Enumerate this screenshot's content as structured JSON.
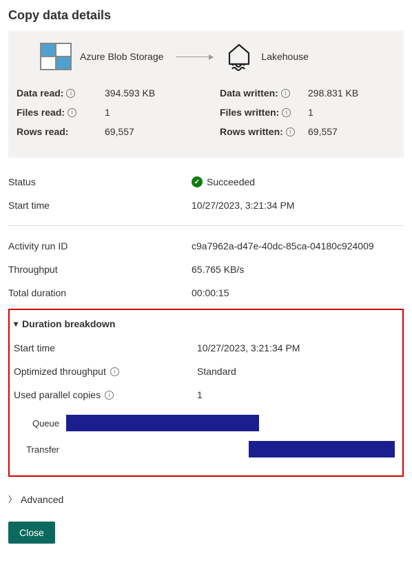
{
  "title": "Copy data details",
  "flow": {
    "source_label": "Azure Blob Storage",
    "dest_label": "Lakehouse"
  },
  "read_metrics": [
    {
      "label": "Data read:",
      "value": "394.593 KB",
      "info": true
    },
    {
      "label": "Files read:",
      "value": "1",
      "info": true
    },
    {
      "label": "Rows read:",
      "value": "69,557",
      "info": false
    }
  ],
  "write_metrics": [
    {
      "label": "Data written:",
      "value": "298.831 KB",
      "info": true
    },
    {
      "label": "Files written:",
      "value": "1",
      "info": true
    },
    {
      "label": "Rows written:",
      "value": "69,557",
      "info": true
    }
  ],
  "status": {
    "label": "Status",
    "value": "Succeeded"
  },
  "start_time": {
    "label": "Start time",
    "value": "10/27/2023, 3:21:34 PM"
  },
  "activity_run_id": {
    "label": "Activity run ID",
    "value": "c9a7962a-d47e-40dc-85ca-04180c924009"
  },
  "throughput": {
    "label": "Throughput",
    "value": "65.765 KB/s"
  },
  "total_duration": {
    "label": "Total duration",
    "value": "00:00:15"
  },
  "breakdown": {
    "header": "Duration breakdown",
    "start_time": {
      "label": "Start time",
      "value": "10/27/2023, 3:21:34 PM"
    },
    "optimized_throughput": {
      "label": "Optimized throughput",
      "value": "Standard"
    },
    "used_parallel_copies": {
      "label": "Used parallel copies",
      "value": "1"
    },
    "gantt": [
      {
        "label": "Queue",
        "left_pct": 0,
        "width_pct": 58
      },
      {
        "label": "Transfer",
        "left_pct": 55,
        "width_pct": 44
      }
    ]
  },
  "advanced_label": "Advanced",
  "close_label": "Close",
  "chart_data": {
    "type": "bar",
    "title": "Duration breakdown",
    "categories": [
      "Queue",
      "Transfer"
    ],
    "series": [
      {
        "name": "start_pct",
        "values": [
          0,
          55
        ]
      },
      {
        "name": "duration_pct",
        "values": [
          58,
          44
        ]
      }
    ],
    "xlabel": "",
    "ylabel": "",
    "ylim": [
      0,
      100
    ]
  }
}
